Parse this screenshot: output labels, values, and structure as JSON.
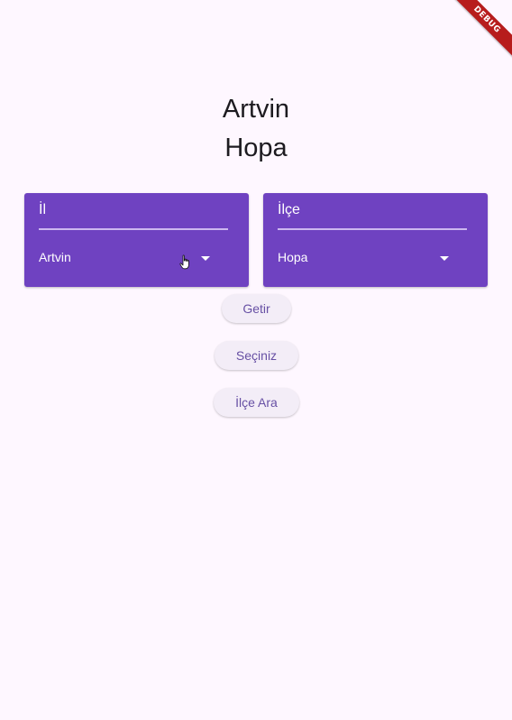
{
  "debug_banner": {
    "label": "DEBUG"
  },
  "header": {
    "selected_il": "Artvin",
    "selected_ilce": "Hopa"
  },
  "il_card": {
    "label": "İl",
    "dropdown_value": "Artvin"
  },
  "ilce_card": {
    "label": "İlçe",
    "dropdown_value": "Hopa"
  },
  "buttons": {
    "getir": "Getir",
    "seciniz": "Seçiniz",
    "ilce_ara": "İlçe Ara"
  },
  "colors": {
    "background": "#fef7ff",
    "card": "#6f42c1",
    "button_bg": "#f3edf7",
    "button_text": "#6750a4",
    "debug_banner": "#b71c1c"
  },
  "icons": {
    "dropdown": "chevron-down-icon",
    "cursor": "hand-cursor-icon"
  }
}
